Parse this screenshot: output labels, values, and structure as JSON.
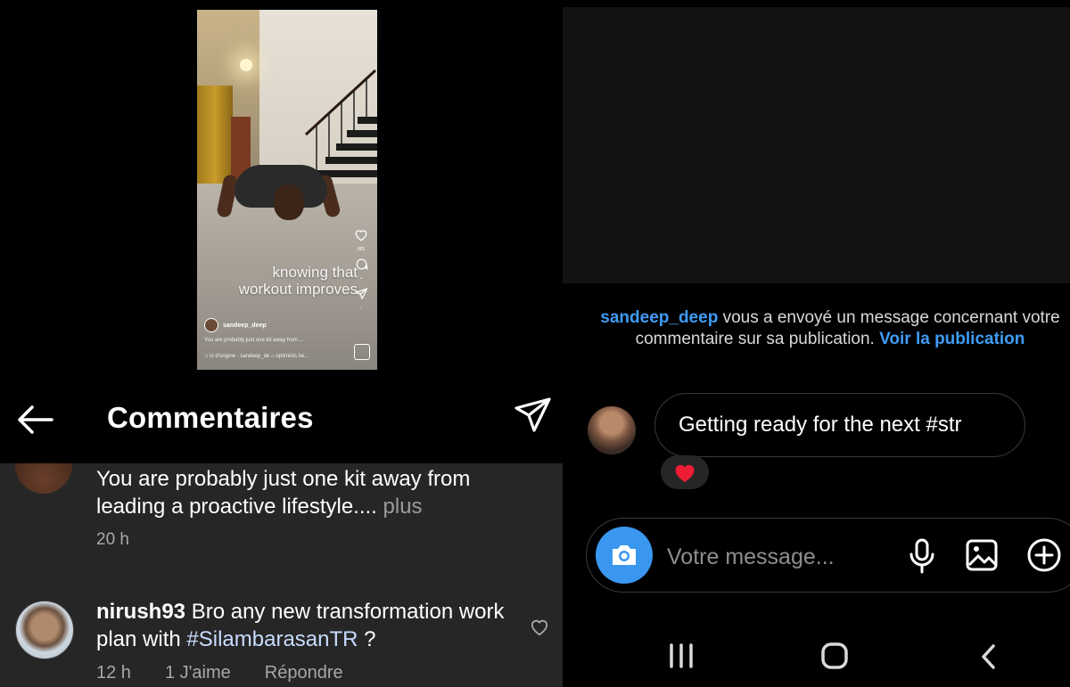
{
  "reel": {
    "overlay_line1": "knowing that",
    "overlay_line2": "workout improves",
    "like_count": "665",
    "username": "sandeep_deep",
    "caption": "You are probably just one kit away from ...",
    "audio": "♫ io d'origine · sandeep_de  ⌂ optimists.he..."
  },
  "comments_header": {
    "title": "Commentaires"
  },
  "comments": [
    {
      "text": "You are probably just one kit away from leading a proactive lifestyle....",
      "more": "plus",
      "time": "20 h"
    },
    {
      "user": "nirush93",
      "text": "Bro any new transformation work plan with",
      "hashtag": "#SilambarasanTR",
      "suffix": "?",
      "time": "12 h",
      "likes": "1 J'aime",
      "reply": "Répondre"
    }
  ],
  "dm": {
    "notice_user": "sandeep_deep",
    "notice_text": "vous a envoyé un message concernant votre commentaire sur sa publication.",
    "notice_link": "Voir la publication",
    "message": "Getting ready for the next #str",
    "reaction": "❤️",
    "input_placeholder": "Votre message..."
  },
  "colors": {
    "accent_blue": "#3f9cf5",
    "camera_button": "#3a97f0",
    "comment_bg": "#262626"
  },
  "icons": {
    "back": "arrow-left-icon",
    "send": "paper-plane-icon",
    "heart": "heart-outline-icon",
    "camera": "camera-icon",
    "mic": "microphone-icon",
    "gallery": "image-icon",
    "plus": "plus-circle-icon",
    "nav_recent": "recent-apps-icon",
    "nav_home": "home-icon",
    "nav_back": "chevron-left-icon"
  }
}
